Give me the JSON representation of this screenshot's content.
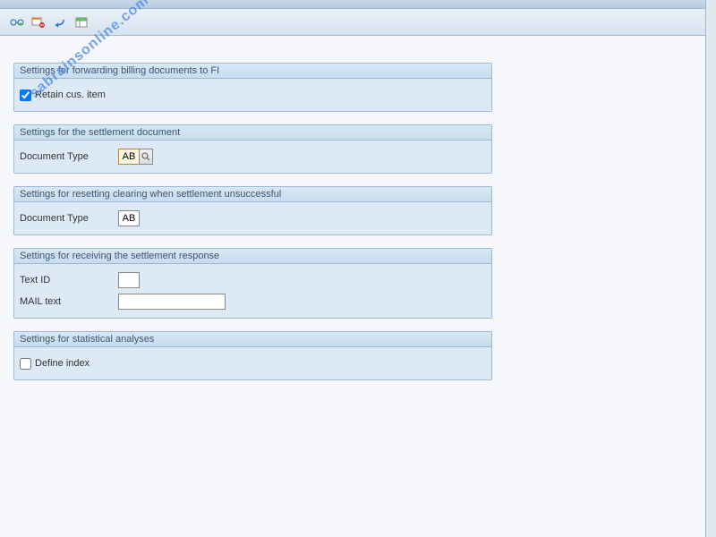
{
  "watermark": "sabrainsonline.com",
  "sections": {
    "forwarding": {
      "title": "Settings for forwarding billing documents to FI",
      "retain_label": "Retain cus. item",
      "retain_checked": true
    },
    "settlement": {
      "title": "Settings for the settlement document",
      "doc_type_label": "Document Type",
      "doc_type_value": "AB"
    },
    "resetting": {
      "title": "Settings for resetting clearing when settlement unsuccessful",
      "doc_type_label": "Document Type",
      "doc_type_value": "AB"
    },
    "receiving": {
      "title": "Settings for receiving the settlement response",
      "text_id_label": "Text ID",
      "text_id_value": "",
      "mail_text_label": "MAIL text",
      "mail_text_value": ""
    },
    "statistical": {
      "title": "Settings for statistical analyses",
      "define_index_label": "Define index",
      "define_index_checked": false
    }
  }
}
